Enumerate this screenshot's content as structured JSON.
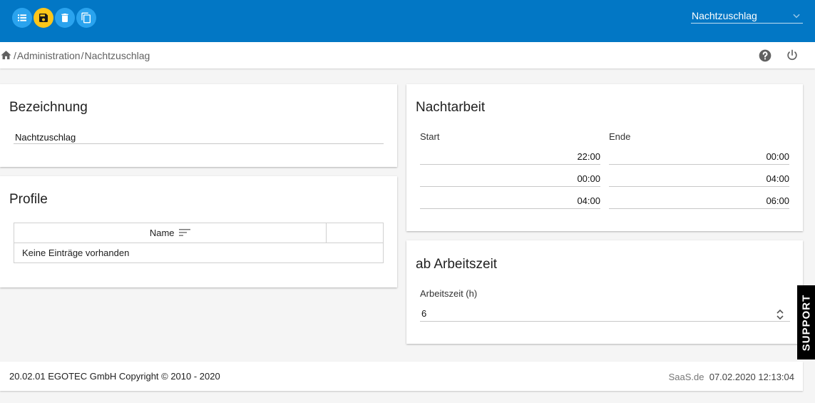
{
  "toolbar": {
    "buttons": [
      {
        "name": "list",
        "icon": "list-icon",
        "color": "#2aa3ee"
      },
      {
        "name": "save",
        "icon": "save-icon",
        "color": "#fdc619"
      },
      {
        "name": "delete",
        "icon": "trash-icon",
        "color": "#2aa3ee"
      },
      {
        "name": "copy",
        "icon": "copy-icon",
        "color": "#2aa3ee"
      }
    ],
    "selected_value": "Nachtzuschlag",
    "bar_color": "#0277c5"
  },
  "breadcrumb": {
    "home_icon": "home-icon",
    "sep": "/",
    "items": [
      "Administration",
      "Nachtzuschlag"
    ]
  },
  "header_icons": {
    "help": "help-icon",
    "power": "power-icon"
  },
  "bezeichnung": {
    "title": "Bezeichnung",
    "value": "Nachtzuschlag"
  },
  "profile": {
    "title": "Profile",
    "columns": [
      "Name",
      ""
    ],
    "empty_text": "Keine Einträge vorhanden"
  },
  "nachtarbeit": {
    "title": "Nachtarbeit",
    "start_label": "Start",
    "end_label": "Ende",
    "rows": [
      {
        "start": "22:00",
        "end": "00:00"
      },
      {
        "start": "00:00",
        "end": "04:00"
      },
      {
        "start": "04:00",
        "end": "06:00"
      }
    ]
  },
  "arbeitszeit": {
    "title": "ab Arbeitszeit",
    "label": "Arbeitszeit (h)",
    "value": "6"
  },
  "footer": {
    "left": "20.02.01 EGOTEC GmbH Copyright © 2010 - 2020",
    "site": "SaaS.de",
    "timestamp": "07.02.2020 12:13:04"
  },
  "support_label": "SUPPORT"
}
